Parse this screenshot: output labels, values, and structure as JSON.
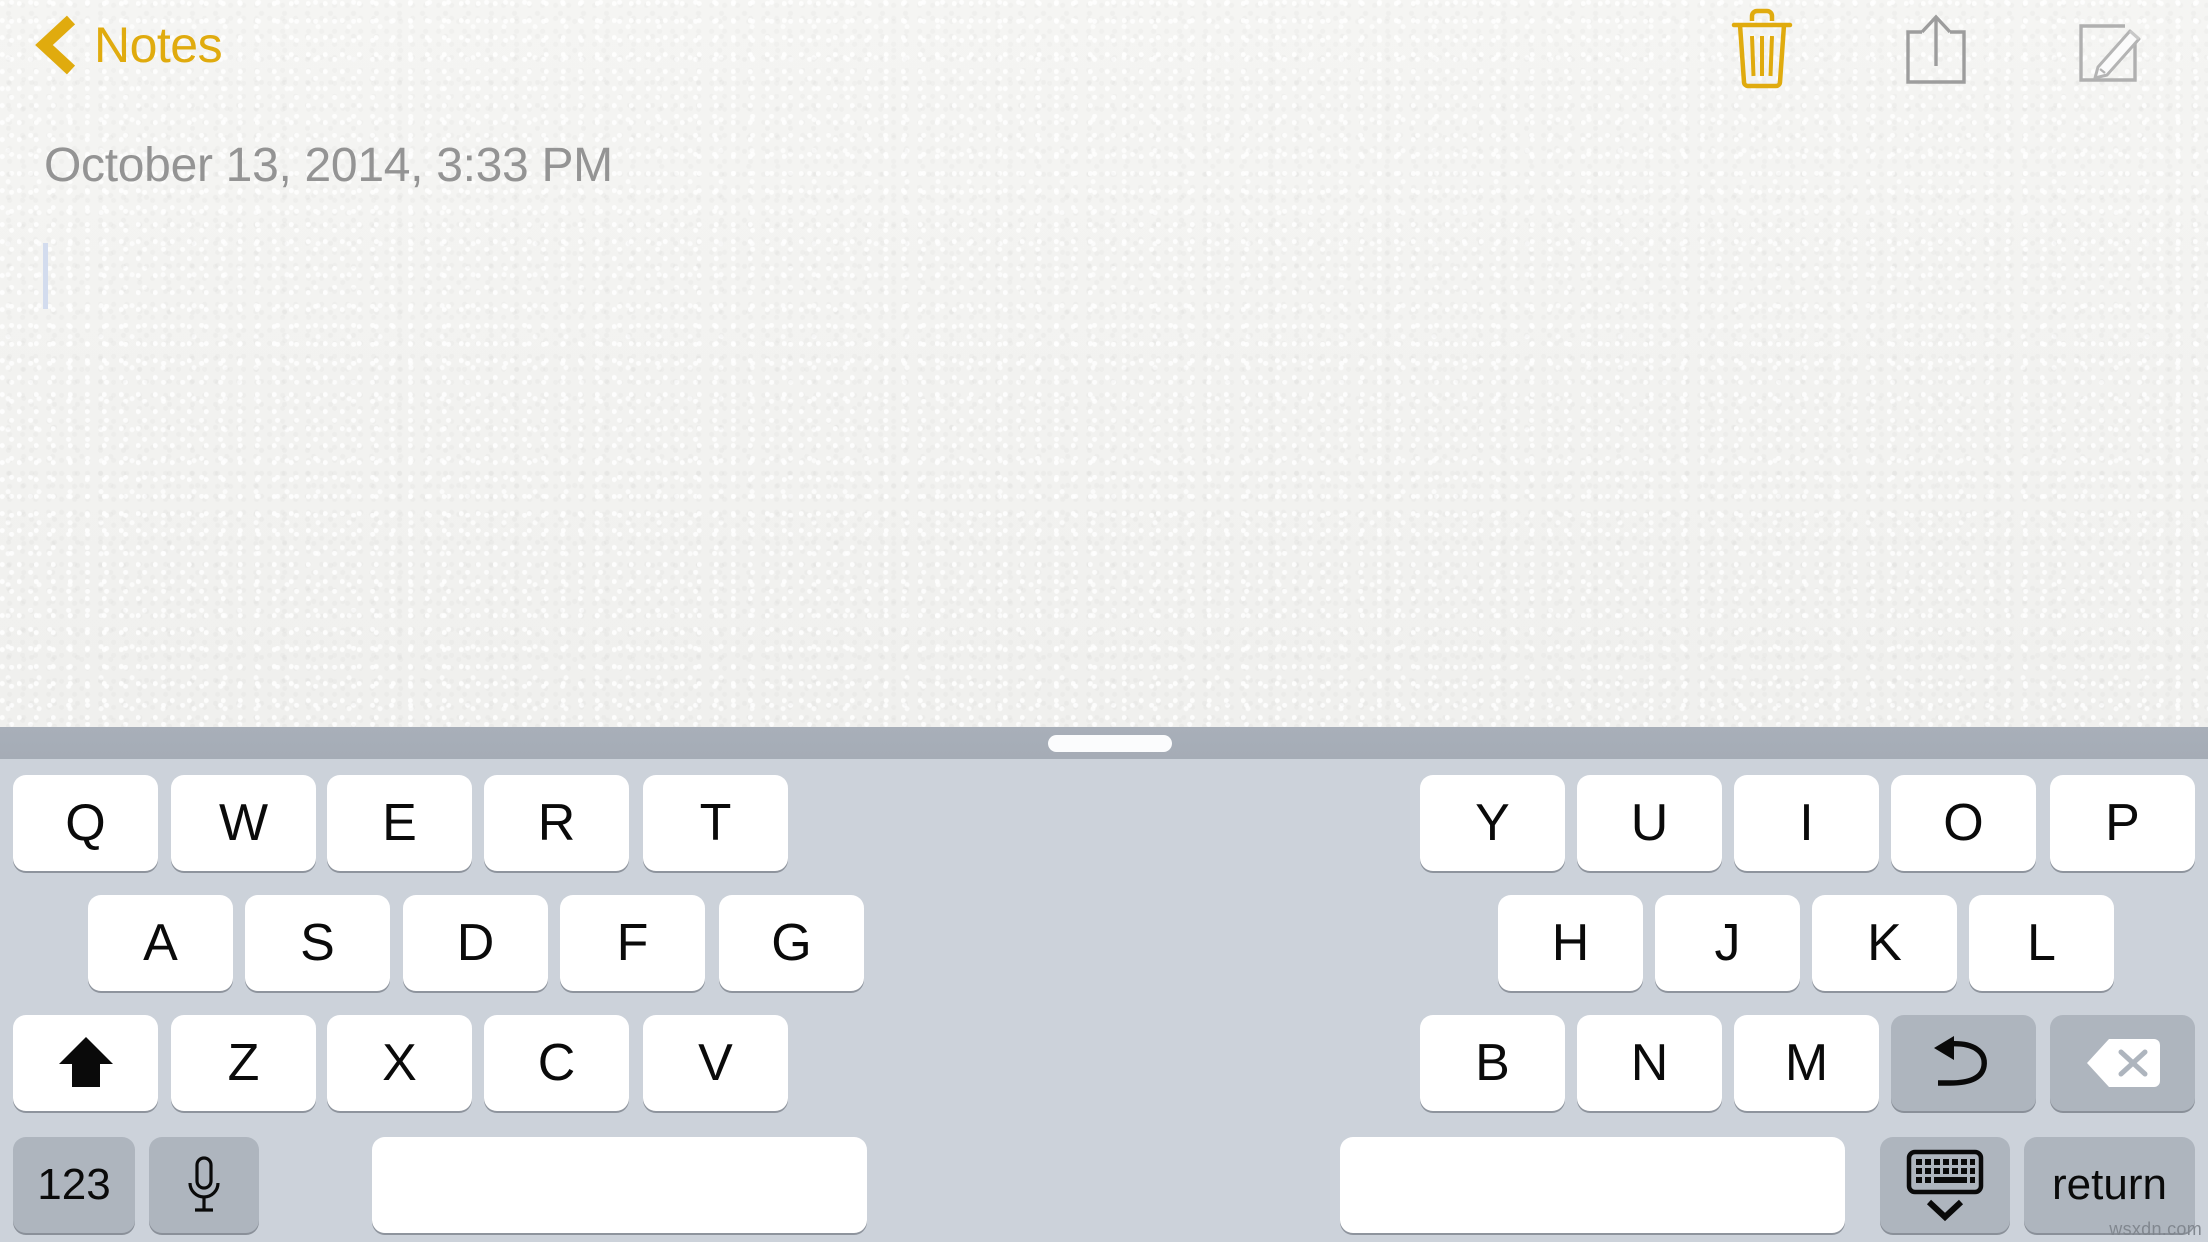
{
  "app": {
    "name": "Notes",
    "accent_color": "#e0ab0e",
    "paper_color": "#f2f2f0",
    "keyboard_bg": "#ccd2da",
    "key_bg": "#ffffff",
    "key_dark_bg": "#aeb5be",
    "cursor_color": "#d3dcee",
    "date_color": "#949494"
  },
  "nav": {
    "back_label": "Notes",
    "back_icon": "chevron-left-icon",
    "actions": [
      {
        "name": "trash-icon",
        "label": "Delete",
        "color": "#e0ab0e"
      },
      {
        "name": "share-icon",
        "label": "Share",
        "color": "#9a9a9a"
      },
      {
        "name": "compose-icon",
        "label": "New Note",
        "color": "#9a9a9a"
      }
    ]
  },
  "note": {
    "timestamp": "October 13, 2014, 3:33 PM",
    "body": "",
    "cursor_visible": true
  },
  "keyboard": {
    "type": "split",
    "drag_handle": "keyboard-drag-handle",
    "left": {
      "row1": [
        "Q",
        "W",
        "E",
        "R",
        "T"
      ],
      "row2": [
        "A",
        "S",
        "D",
        "F",
        "G"
      ],
      "row3": [
        "Z",
        "X",
        "C",
        "V"
      ],
      "shift_icon": "shift-up-arrow-icon",
      "numbers_label": "123",
      "mic_icon": "microphone-icon",
      "space_label": ""
    },
    "right": {
      "row1": [
        "Y",
        "U",
        "I",
        "O",
        "P"
      ],
      "row2": [
        "H",
        "J",
        "K",
        "L"
      ],
      "row3": [
        "B",
        "N",
        "M"
      ],
      "undo_icon": "undo-arrow-icon",
      "delete_icon": "backspace-delete-icon",
      "space_label": "",
      "hide_keyboard_icon": "hide-keyboard-icon",
      "return_label": "return"
    }
  },
  "watermark": {
    "text": "wsxdn.com"
  }
}
